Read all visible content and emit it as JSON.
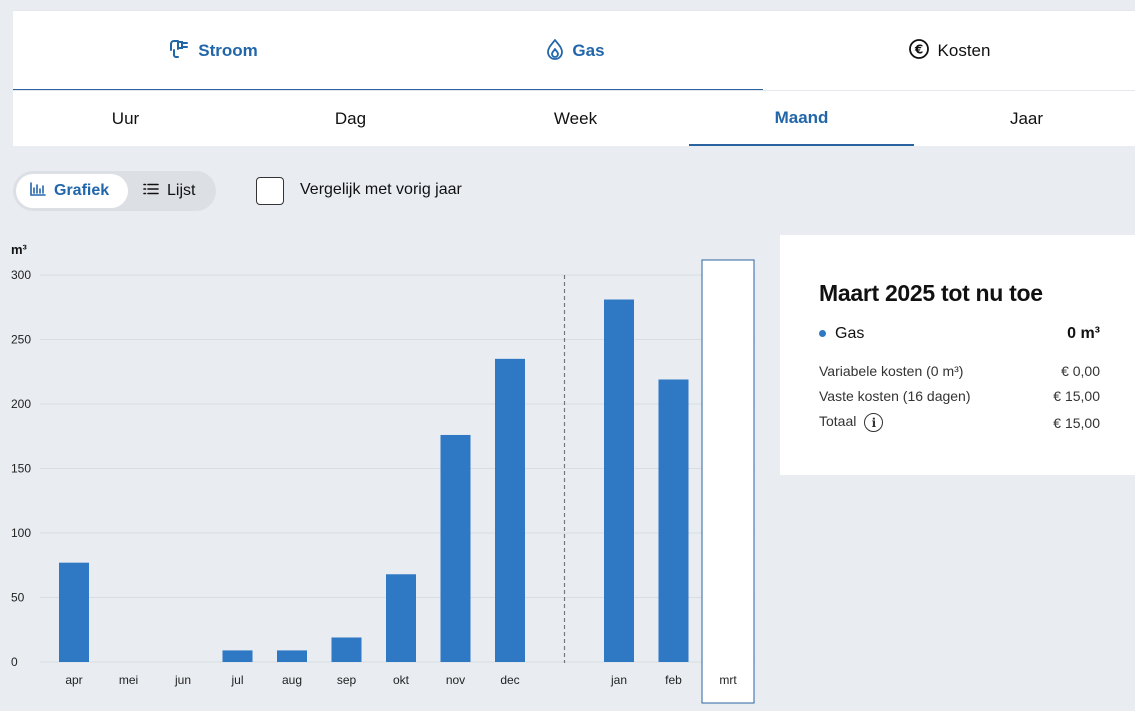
{
  "top_tabs": [
    {
      "label": "Stroom",
      "icon": "plug-icon",
      "active": true
    },
    {
      "label": "Gas",
      "icon": "flame-icon",
      "active": true
    },
    {
      "label": "Kosten",
      "icon": "euro-icon",
      "active": false
    }
  ],
  "period_tabs": [
    {
      "label": "Uur"
    },
    {
      "label": "Dag"
    },
    {
      "label": "Week"
    },
    {
      "label": "Maand",
      "active": true
    },
    {
      "label": "Jaar"
    }
  ],
  "view_toggle": {
    "chart_label": "Grafiek",
    "list_label": "Lijst",
    "selected": "Grafiek"
  },
  "compare": {
    "label": "Vergelijk met vorig jaar",
    "checked": false
  },
  "colors": {
    "accent": "#2266aa",
    "bar": "#2f78c4"
  },
  "chart_data": {
    "type": "bar",
    "ylabel": "m³",
    "ylim": [
      0,
      300
    ],
    "yticks": [
      0,
      50,
      100,
      150,
      200,
      250,
      300
    ],
    "categories": [
      "apr",
      "mei",
      "jun",
      "jul",
      "aug",
      "sep",
      "okt",
      "nov",
      "dec",
      "jan",
      "feb",
      "mrt"
    ],
    "values": [
      77,
      0,
      0,
      9,
      9,
      19,
      68,
      176,
      235,
      281,
      219,
      0
    ],
    "year_divider_after": "dec",
    "selected": "mrt",
    "grid": true
  },
  "summary": {
    "title": "Maart 2025 tot nu toe",
    "gas_label": "Gas",
    "gas_value": "0 m³",
    "rows": [
      {
        "label": "Variabele kosten (0 m³)",
        "value": "€ 0,00"
      },
      {
        "label": "Vaste kosten (16 dagen)",
        "value": "€ 15,00"
      },
      {
        "label": "Totaal",
        "value": "€ 15,00"
      }
    ]
  }
}
